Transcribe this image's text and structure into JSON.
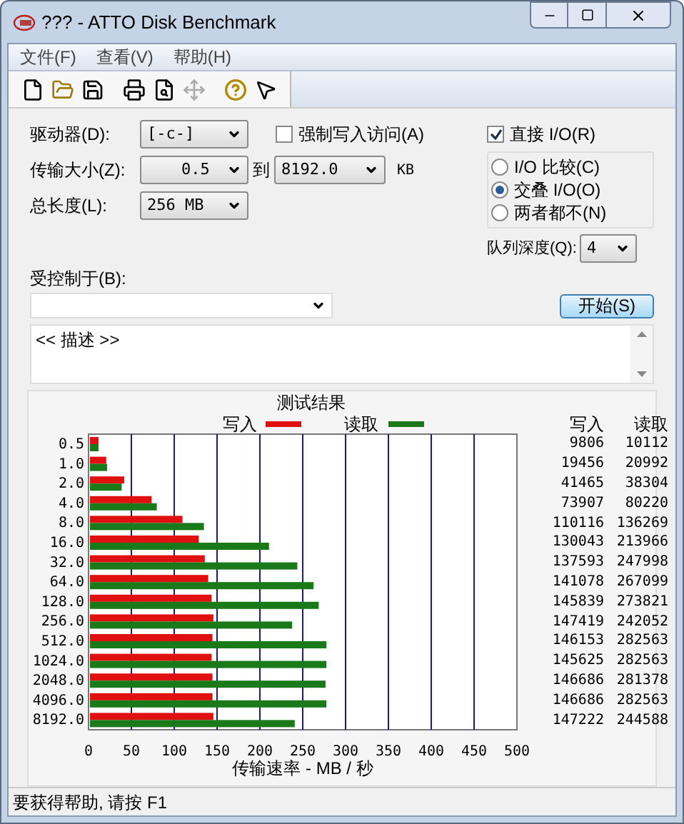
{
  "window": {
    "title": "??? - ATTO Disk Benchmark"
  },
  "menu": [
    {
      "label": "文件(F)"
    },
    {
      "label": "查看(V)"
    },
    {
      "label": "帮助(H)"
    }
  ],
  "toolbar": [
    {
      "kind": "new",
      "disabled": false
    },
    {
      "kind": "open",
      "disabled": false
    },
    {
      "kind": "save",
      "disabled": false
    },
    {
      "kind": "print",
      "disabled": false
    },
    {
      "kind": "preview",
      "disabled": false
    },
    {
      "kind": "move",
      "disabled": true
    },
    {
      "kind": "help",
      "disabled": false
    },
    {
      "kind": "context-help",
      "disabled": false
    }
  ],
  "form": {
    "drive": {
      "label": "驱动器(D):",
      "value": "[-c-]"
    },
    "force_write": {
      "label": "强制写入访问(A)",
      "checked": false
    },
    "transfer_size": {
      "label": "传输大小(Z):",
      "from": "0.5",
      "to_label": "到",
      "to": "8192.0",
      "unit": "KB"
    },
    "total_length": {
      "label": "总长度(L):",
      "value": "256 MB"
    },
    "direct_io": {
      "label": "直接 I/O(R)",
      "checked": true
    },
    "io_modes": [
      {
        "label": "I/O 比较(C)",
        "selected": false
      },
      {
        "label": "交叠 I/O(O)",
        "selected": true
      },
      {
        "label": "两者都不(N)",
        "selected": false
      }
    ],
    "queue_depth": {
      "label": "队列深度(Q):",
      "value": "4"
    },
    "controlled_by": {
      "label": "受控制于(B):"
    },
    "start_button": "开始(S)",
    "description": "<< 描述 >>"
  },
  "results": {
    "columns": [
      "写入",
      "读取"
    ],
    "rows": [
      {
        "write": "9806",
        "read": "10112"
      },
      {
        "write": "19456",
        "read": "20992"
      },
      {
        "write": "41465",
        "read": "38304"
      },
      {
        "write": "73907",
        "read": "80220"
      },
      {
        "write": "110116",
        "read": "136269"
      },
      {
        "write": "130043",
        "read": "213966"
      },
      {
        "write": "137593",
        "read": "247998"
      },
      {
        "write": "141078",
        "read": "267099"
      },
      {
        "write": "145839",
        "read": "273821"
      },
      {
        "write": "147419",
        "read": "242052"
      },
      {
        "write": "146153",
        "read": "282563"
      },
      {
        "write": "145625",
        "read": "282563"
      },
      {
        "write": "146686",
        "read": "281378"
      },
      {
        "write": "146686",
        "read": "282563"
      },
      {
        "write": "147222",
        "read": "244588"
      }
    ],
    "chart_data": {
      "type": "bar",
      "orientation": "horizontal",
      "title": "测试结果",
      "xlabel": "传输速率 - MB / 秒",
      "categories": [
        "0.5",
        "1.0",
        "2.0",
        "4.0",
        "8.0",
        "16.0",
        "32.0",
        "64.0",
        "128.0",
        "256.0",
        "512.0",
        "1024.0",
        "2048.0",
        "4096.0",
        "8192.0"
      ],
      "series": [
        {
          "name": "写入",
          "color": "#e01010",
          "values": [
            10,
            19,
            40,
            72,
            108,
            127,
            134,
            138,
            142,
            144,
            143,
            142,
            143,
            143,
            144
          ]
        },
        {
          "name": "读取",
          "color": "#1a7a1a",
          "values": [
            10,
            20,
            37,
            78,
            133,
            209,
            242,
            261,
            267,
            236,
            276,
            276,
            275,
            276,
            239
          ]
        }
      ],
      "grid": true,
      "legend": true,
      "xlim": [
        0,
        500
      ],
      "xticks": [
        0,
        50,
        100,
        150,
        200,
        250,
        300,
        350,
        400,
        450,
        500
      ]
    }
  },
  "status_bar": "要获得帮助, 请按 F1"
}
